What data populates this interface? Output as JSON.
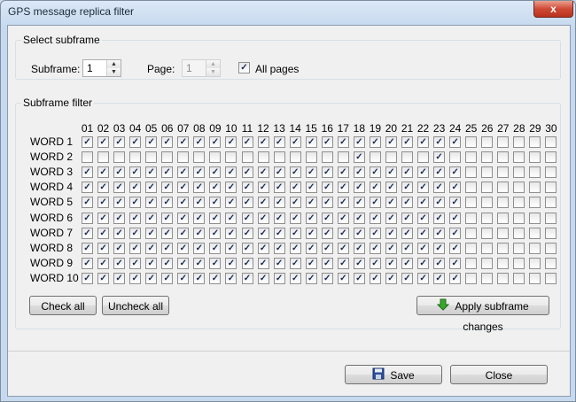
{
  "window": {
    "title": "GPS message replica filter",
    "close_glyph": "x"
  },
  "select_subframe": {
    "group_label": "Select subframe",
    "subframe_label": "Subframe:",
    "subframe_value": "1",
    "page_label": "Page:",
    "page_value": "1",
    "all_pages_label": "All pages",
    "all_pages_checked": true
  },
  "subframe_filter": {
    "group_label": "Subframe filter",
    "columns": [
      "01",
      "02",
      "03",
      "04",
      "05",
      "06",
      "07",
      "08",
      "09",
      "10",
      "11",
      "12",
      "13",
      "14",
      "15",
      "16",
      "17",
      "18",
      "19",
      "20",
      "21",
      "22",
      "23",
      "24",
      "25",
      "26",
      "27",
      "28",
      "29",
      "30"
    ],
    "rows": [
      {
        "label": "WORD 1",
        "checked": [
          1,
          2,
          3,
          4,
          5,
          6,
          7,
          8,
          9,
          10,
          11,
          12,
          13,
          14,
          15,
          16,
          17,
          18,
          19,
          20,
          21,
          22,
          23,
          24
        ]
      },
      {
        "label": "WORD 2",
        "checked": [
          18,
          23
        ]
      },
      {
        "label": "WORD 3",
        "checked": [
          1,
          2,
          3,
          4,
          5,
          6,
          7,
          8,
          9,
          10,
          11,
          12,
          13,
          14,
          15,
          16,
          17,
          18,
          19,
          20,
          21,
          22,
          23,
          24
        ]
      },
      {
        "label": "WORD 4",
        "checked": [
          1,
          2,
          3,
          4,
          5,
          6,
          7,
          8,
          9,
          10,
          11,
          12,
          13,
          14,
          15,
          16,
          17,
          18,
          19,
          20,
          21,
          22,
          23,
          24
        ]
      },
      {
        "label": "WORD 5",
        "checked": [
          1,
          2,
          3,
          4,
          5,
          6,
          7,
          8,
          9,
          10,
          11,
          12,
          13,
          14,
          15,
          16,
          17,
          18,
          19,
          20,
          21,
          22,
          23,
          24
        ]
      },
      {
        "label": "WORD 6",
        "checked": [
          1,
          2,
          3,
          4,
          5,
          6,
          7,
          8,
          9,
          10,
          11,
          12,
          13,
          14,
          15,
          16,
          17,
          18,
          19,
          20,
          21,
          22,
          23,
          24
        ]
      },
      {
        "label": "WORD 7",
        "checked": [
          1,
          2,
          3,
          4,
          5,
          6,
          7,
          8,
          9,
          10,
          11,
          12,
          13,
          14,
          15,
          16,
          17,
          18,
          19,
          20,
          21,
          22,
          23,
          24
        ]
      },
      {
        "label": "WORD 8",
        "checked": [
          1,
          2,
          3,
          4,
          5,
          6,
          7,
          8,
          9,
          10,
          11,
          12,
          13,
          14,
          15,
          16,
          17,
          18,
          19,
          20,
          21,
          22,
          23,
          24
        ]
      },
      {
        "label": "WORD 9",
        "checked": [
          1,
          2,
          3,
          4,
          5,
          6,
          7,
          8,
          9,
          10,
          11,
          12,
          13,
          14,
          15,
          16,
          17,
          18,
          19,
          20,
          21,
          22,
          23,
          24
        ]
      },
      {
        "label": "WORD 10",
        "checked": [
          1,
          2,
          3,
          4,
          5,
          6,
          7,
          8,
          9,
          10,
          11,
          12,
          13,
          14,
          15,
          16,
          17,
          18,
          19,
          20,
          21,
          22,
          23,
          24
        ]
      }
    ],
    "check_all_label": "Check all",
    "uncheck_all_label": "Uncheck all",
    "apply_label": "Apply subframe changes",
    "apply_icon": "green-down-arrow-icon"
  },
  "footer": {
    "save_label": "Save",
    "save_icon": "floppy-disk-icon",
    "close_label": "Close"
  }
}
